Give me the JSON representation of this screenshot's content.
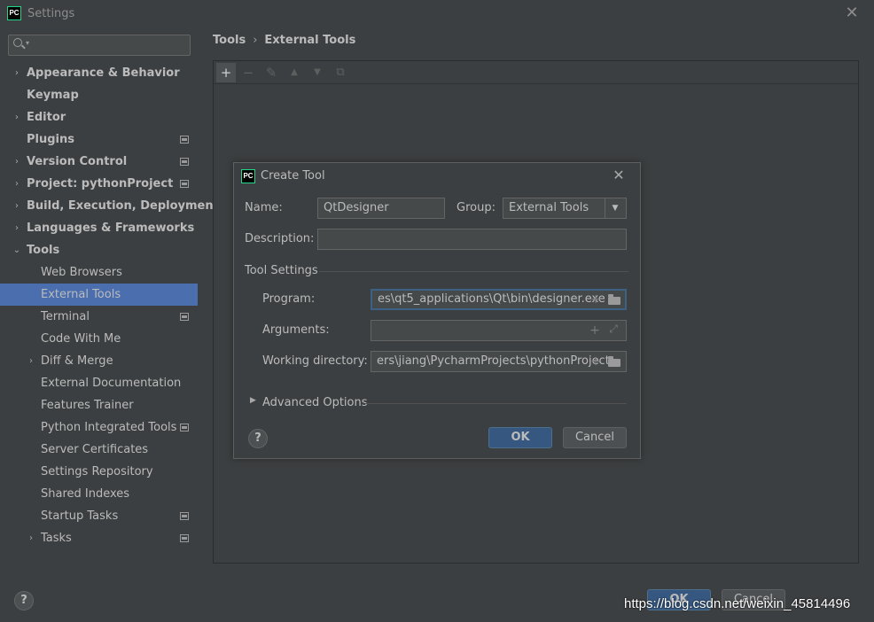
{
  "window": {
    "title": "Settings",
    "app_icon_text": "PC"
  },
  "search": {
    "placeholder": ""
  },
  "sidebar": {
    "items": [
      {
        "label": "Appearance & Behavior",
        "arrow": "›"
      },
      {
        "label": "Keymap"
      },
      {
        "label": "Editor",
        "arrow": "›"
      },
      {
        "label": "Plugins"
      },
      {
        "label": "Version Control",
        "arrow": "›"
      },
      {
        "label": "Project: pythonProject",
        "arrow": "›"
      },
      {
        "label": "Build, Execution, Deployment",
        "arrow": "›"
      },
      {
        "label": "Languages & Frameworks",
        "arrow": "›"
      },
      {
        "label": "Tools",
        "arrow": "⌄"
      },
      {
        "label": "Web Browsers"
      },
      {
        "label": "External Tools"
      },
      {
        "label": "Terminal"
      },
      {
        "label": "Code With Me"
      },
      {
        "label": "Diff & Merge",
        "arrow": "›"
      },
      {
        "label": "External Documentation"
      },
      {
        "label": "Features Trainer"
      },
      {
        "label": "Python Integrated Tools"
      },
      {
        "label": "Server Certificates"
      },
      {
        "label": "Settings Repository"
      },
      {
        "label": "Shared Indexes"
      },
      {
        "label": "Startup Tasks"
      },
      {
        "label": "Tasks",
        "arrow": "›"
      }
    ]
  },
  "breadcrumb": {
    "parent": "Tools",
    "separator": "›",
    "current": "External Tools"
  },
  "toolbar": {
    "add_icon": "+",
    "remove_icon": "−",
    "edit_icon": "✎",
    "up_icon": "▲",
    "down_icon": "▼",
    "copy_icon": "⧉"
  },
  "dialog": {
    "title": "Create Tool",
    "icon_text": "PC",
    "close_icon": "✕",
    "name_label": "Name:",
    "name_value": "QtDesigner",
    "group_label": "Group:",
    "group_value": "External Tools",
    "description_label": "Description:",
    "description_value": "",
    "tool_settings_label": "Tool Settings",
    "program_label": "Program:",
    "program_value": "es\\qt5_applications\\Qt\\bin\\designer.exe",
    "arguments_label": "Arguments:",
    "arguments_value": "",
    "working_dir_label": "Working directory:",
    "working_dir_value": "ers\\jiang\\PycharmProjects\\pythonProject",
    "advanced_label": "Advanced Options",
    "help_label": "?",
    "ok_label": "OK",
    "cancel_label": "Cancel",
    "plus_icon": "+",
    "expand_icon": "⤢",
    "combo_arrow": "▼",
    "advanced_arrow": "▶"
  },
  "footer": {
    "help_label": "?",
    "ok_label": "OK",
    "cancel_label": "Cancel"
  },
  "watermark": "https://blog.csdn.net/weixin_45814496",
  "colors": {
    "background": "#3c3f41",
    "selection": "#4b6eaf",
    "primary_button": "#365880",
    "focus_border": "#3d6185"
  }
}
